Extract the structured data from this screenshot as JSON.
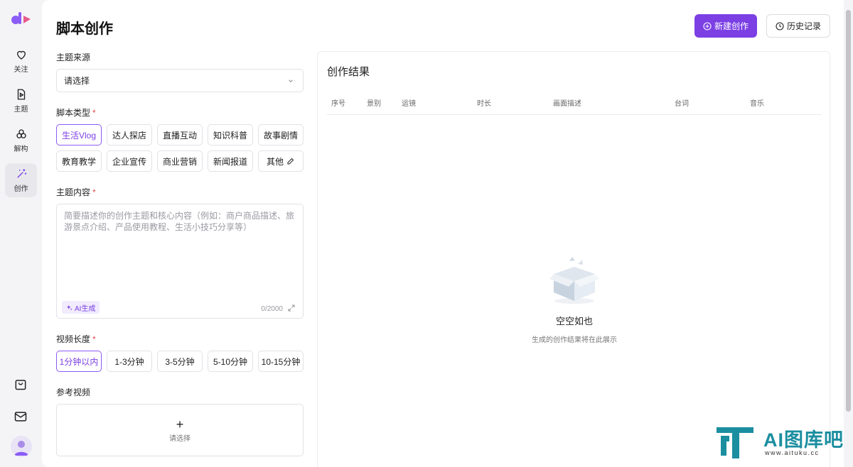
{
  "sidebar": {
    "items": [
      {
        "label": "关注",
        "icon": "heart-icon"
      },
      {
        "label": "主题",
        "icon": "document-play-icon"
      },
      {
        "label": "解构",
        "icon": "circles-icon"
      },
      {
        "label": "创作",
        "icon": "magic-wand-icon"
      }
    ],
    "bottom_icons": [
      "shopping-bag-icon",
      "mail-icon",
      "avatar"
    ]
  },
  "header": {
    "title": "脚本创作",
    "new_button": "新建创作",
    "history_button": "历史记录"
  },
  "form": {
    "source": {
      "label": "主题来源",
      "value": "请选择"
    },
    "script_type": {
      "label": "脚本类型",
      "required_mark": "*",
      "options": [
        "生活Vlog",
        "达人探店",
        "直播互动",
        "知识科普",
        "故事剧情",
        "教育教学",
        "企业宣传",
        "商业营销",
        "新闻报道",
        "其他"
      ],
      "selected": "生活Vlog"
    },
    "content": {
      "label": "主题内容",
      "required_mark": "*",
      "placeholder": "简要描述你的创作主题和核心内容（例如：商户商品描述、旅游景点介绍、产品使用教程、生活小技巧分享等）",
      "ai_button": "AI生成",
      "counter": "0/2000"
    },
    "duration": {
      "label": "视频长度",
      "required_mark": "*",
      "options": [
        "1分钟以内",
        "1-3分钟",
        "3-5分钟",
        "5-10分钟",
        "10-15分钟"
      ],
      "selected": "1分钟以内"
    },
    "reference": {
      "label": "参考视频",
      "plus": "+",
      "upload_text": "请选择"
    }
  },
  "result": {
    "title": "创作结果",
    "columns": [
      "序号",
      "景别",
      "运镜",
      "时长",
      "画面描述",
      "台词",
      "音乐"
    ],
    "empty_title": "空空如也",
    "empty_subtitle": "生成的创作结果将在此展示"
  },
  "watermark": {
    "title": "AI图库吧",
    "subtitle": "www.aituku.cc"
  },
  "colors": {
    "accent": "#7b3fe4",
    "required": "#e24c4c",
    "watermark": "#1b8ea0"
  }
}
